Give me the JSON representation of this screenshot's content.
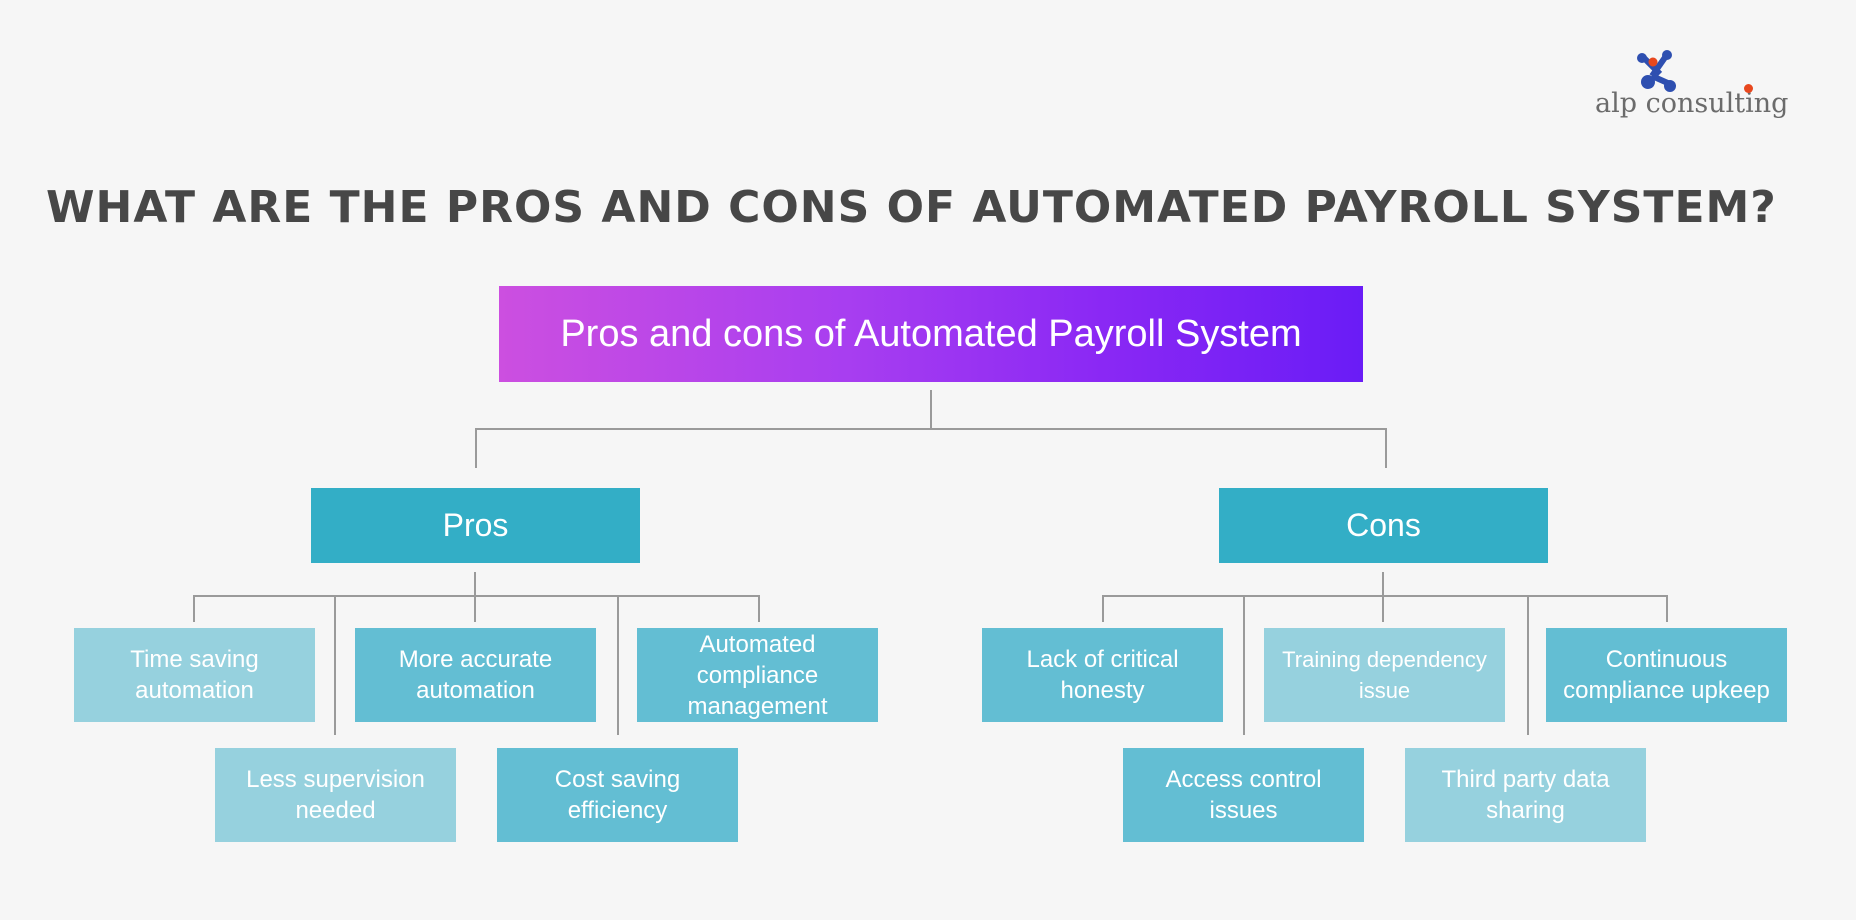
{
  "brand": {
    "name": "alp consulting",
    "logo_icon": "molecule-icon",
    "colors": {
      "blue": "#2e4fb0",
      "orange": "#e8481e",
      "text": "#6b6b6b"
    }
  },
  "heading": "WHAT ARE THE PROS AND CONS OF AUTOMATED PAYROLL SYSTEM?",
  "diagram": {
    "root": {
      "label": "Pros and cons of Automated Payroll System",
      "gradient": [
        "#cc4fe0",
        "#6a1cf6"
      ]
    },
    "branches": [
      {
        "label": "Pros",
        "color": "#33aec6",
        "items": [
          {
            "label": "Time saving automation",
            "shade": "light"
          },
          {
            "label": "Less supervision needed",
            "shade": "light"
          },
          {
            "label": "More accurate automation",
            "shade": "dark"
          },
          {
            "label": "Cost saving efficiency",
            "shade": "dark"
          },
          {
            "label": "Automated compliance management",
            "shade": "dark"
          }
        ]
      },
      {
        "label": "Cons",
        "color": "#33aec6",
        "items": [
          {
            "label": "Lack of critical honesty",
            "shade": "dark"
          },
          {
            "label": "Access control issues",
            "shade": "dark"
          },
          {
            "label": "Training dependency issue",
            "shade": "light"
          },
          {
            "label": "Third party data sharing",
            "shade": "light"
          },
          {
            "label": "Continuous compliance upkeep",
            "shade": "dark"
          }
        ]
      }
    ],
    "shades": {
      "dark": "#63bed3",
      "light": "#96d1de"
    }
  }
}
